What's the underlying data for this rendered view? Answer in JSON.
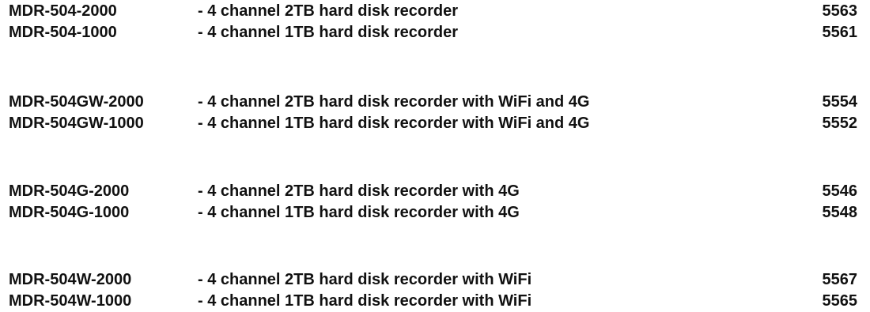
{
  "products": [
    {
      "model": "MDR-504-2000",
      "description": "- 4 channel 2TB hard disk recorder",
      "code": "5563"
    },
    {
      "model": "MDR-504-1000",
      "description": "- 4 channel 1TB hard disk recorder",
      "code": "5561"
    },
    {
      "model": "MDR-504GW-2000",
      "description": "- 4 channel 2TB hard disk recorder with WiFi and 4G",
      "code": "5554"
    },
    {
      "model": "MDR-504GW-1000",
      "description": "- 4 channel 1TB hard disk recorder with WiFi and 4G",
      "code": "5552"
    },
    {
      "model": "MDR-504G-2000",
      "description": "- 4 channel 2TB hard disk recorder with 4G",
      "code": "5546"
    },
    {
      "model": "MDR-504G-1000",
      "description": "- 4 channel 1TB hard disk recorder with 4G",
      "code": "5548"
    },
    {
      "model": "MDR-504W-2000",
      "description": "- 4 channel 2TB hard disk recorder with WiFi",
      "code": "5567"
    },
    {
      "model": "MDR-504W-1000",
      "description": "- 4 channel 1TB hard disk recorder with WiFi",
      "code": "5565"
    }
  ]
}
